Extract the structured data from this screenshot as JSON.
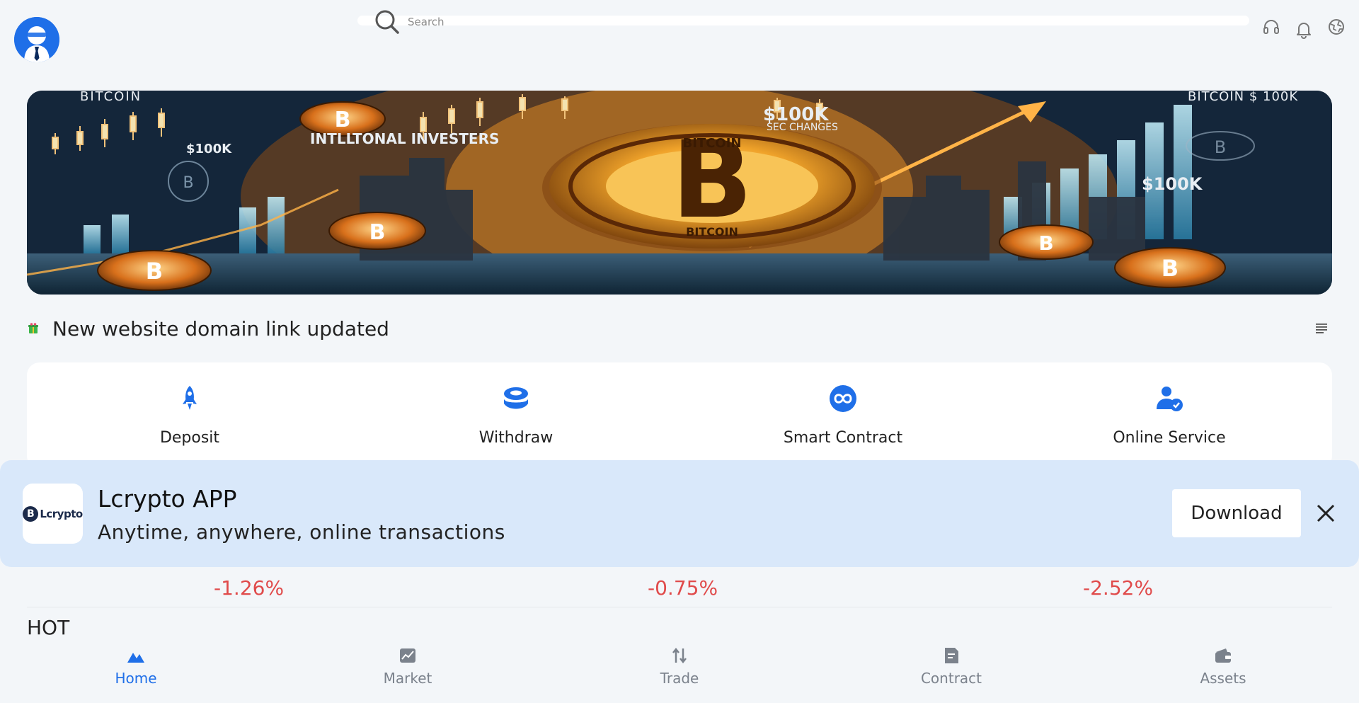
{
  "header": {
    "search_placeholder": "Search",
    "icons": [
      "user-avatar",
      "headset-icon",
      "bell-icon",
      "language-icon"
    ]
  },
  "banner": {
    "texts": {
      "top_left": "BITCOIN",
      "price_left": "$100K",
      "investors": "INTLLTONAL INVESTERS",
      "top_center": "$100K",
      "sec_changes": "SEC CHANGES",
      "coin_ring_top": "BITCOIN",
      "coin_ring_bottom": "BITCOIN",
      "top_right": "BITCOIN $ 100K",
      "price_right": "$100K"
    }
  },
  "notice": {
    "text": "New website domain link updated"
  },
  "actions": [
    {
      "label": "Deposit",
      "icon": "rocket-icon"
    },
    {
      "label": "Withdraw",
      "icon": "stack-icon"
    },
    {
      "label": "Smart Contract",
      "icon": "infinity-icon"
    },
    {
      "label": "Online Service",
      "icon": "user-check-icon"
    }
  ],
  "market_changes": [
    "-1.26%",
    "-0.75%",
    "-2.52%"
  ],
  "hot_label": "HOT",
  "app_banner": {
    "logo_text": "Lcrypto",
    "title": "Lcrypto APP",
    "subtitle": "Anytime, anywhere, online transactions",
    "download_label": "Download"
  },
  "bottom_nav": [
    {
      "label": "Home",
      "icon": "home-icon",
      "active": true
    },
    {
      "label": "Market",
      "icon": "chart-icon",
      "active": false
    },
    {
      "label": "Trade",
      "icon": "swap-icon",
      "active": false
    },
    {
      "label": "Contract",
      "icon": "document-icon",
      "active": false
    },
    {
      "label": "Assets",
      "icon": "wallet-icon",
      "active": false
    }
  ],
  "colors": {
    "accent": "#1f6fe8",
    "negative": "#e04b4b",
    "background": "#f3f6f9",
    "app_banner_bg": "#d9e8fa"
  }
}
